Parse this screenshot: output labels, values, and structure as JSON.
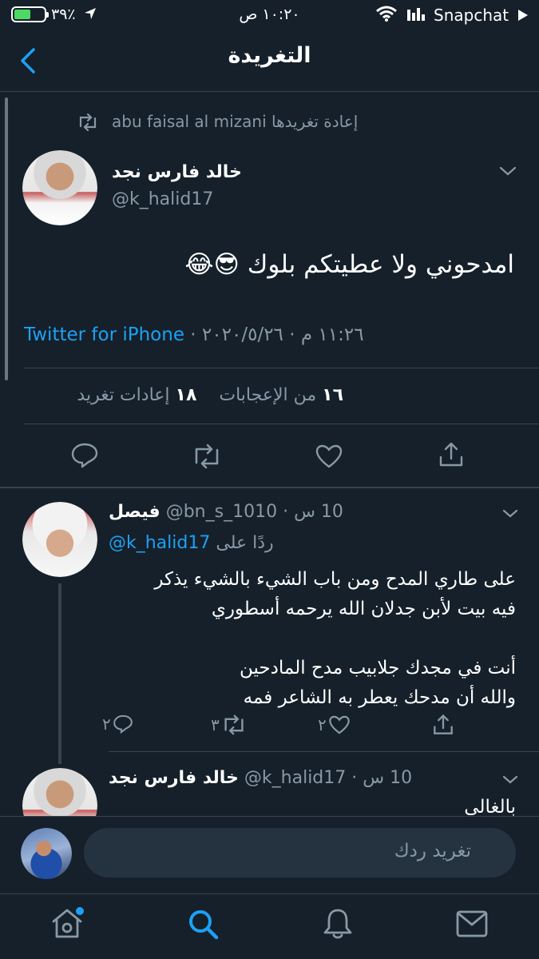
{
  "status_bar": {
    "battery": "٣٩٪",
    "time": "١٠:٢٠ ص",
    "carrier": "Snapchat"
  },
  "header": {
    "title": "التغريدة"
  },
  "main_tweet": {
    "retweeted_by": "abu faisal al mizani إعادة تغريدها",
    "display_name": "خالد فارس نجد",
    "handle": "@k_halid17",
    "text": "امدحوني ولا عطيتكم بلوك 😎😂",
    "source": "Twitter for iPhone",
    "timestamp": "١١:٢٦ م · ٢٠٢٠/٥/٢٦ · ",
    "likes_count": "١٦",
    "likes_label": "من الإعجابات",
    "retweets_count": "١٨",
    "retweets_label": "إعادات تغريد"
  },
  "replies": [
    {
      "display_name": "فيصل",
      "handle": "@bn_s_1010",
      "time": "10 س",
      "replying_prefix": "ردًا على",
      "replying_to": "@k_halid17",
      "lines": [
        "على طاري المدح ومن باب الشيء بالشيء يذكر",
        "فيه بيت لأبن جدلان الله يرحمه أسطوري",
        "",
        "أنت في مجدك جلابيب مدح المادحين",
        "والله أن مدحك يعطر به الشاعر فمه"
      ],
      "reply_count": "٢",
      "retweet_count": "٣",
      "like_count": "٢"
    },
    {
      "display_name": "خالد فارس نجد",
      "handle": "@k_halid17",
      "time": "10 س",
      "text": "بالغالي"
    }
  ],
  "composer": {
    "placeholder": "تغريد ردك"
  },
  "tab_bar": {
    "items": [
      "home-icon",
      "search-icon",
      "bell-icon",
      "mail-icon"
    ],
    "active": "search-icon"
  },
  "colors": {
    "background": "#15202b",
    "accent": "#1da1f2",
    "muted": "#8899a6"
  }
}
